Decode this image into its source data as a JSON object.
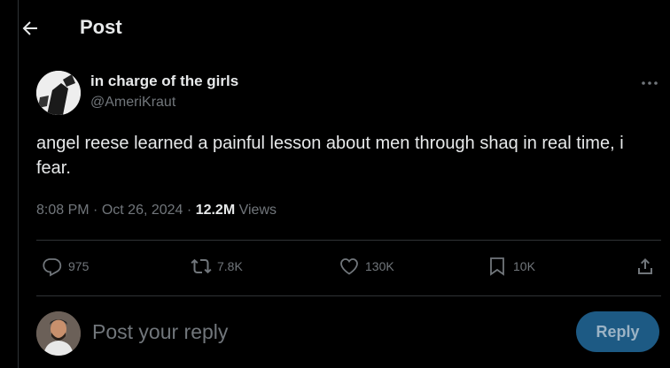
{
  "header": {
    "title": "Post"
  },
  "post": {
    "display_name": "in charge of the girls",
    "handle": "@AmeriKraut",
    "text": "angel reese learned a painful lesson about men through shaq in real time, i fear.",
    "time": "8:08 PM",
    "date": "Oct 26, 2024",
    "separator": "·",
    "views_count": "12.2M",
    "views_label": "Views"
  },
  "actions": {
    "replies": "975",
    "reposts": "7.8K",
    "likes": "130K",
    "bookmarks": "10K"
  },
  "reply_box": {
    "placeholder": "Post your reply",
    "button_label": "Reply"
  },
  "colors": {
    "background": "#000000",
    "text": "#e7e9ea",
    "secondary_text": "#71767b",
    "divider": "#2f3336",
    "reply_button": "#1d5a84"
  },
  "icons": [
    "back-arrow-icon",
    "more-icon",
    "reply-icon",
    "repost-icon",
    "like-icon",
    "bookmark-icon",
    "share-icon"
  ]
}
